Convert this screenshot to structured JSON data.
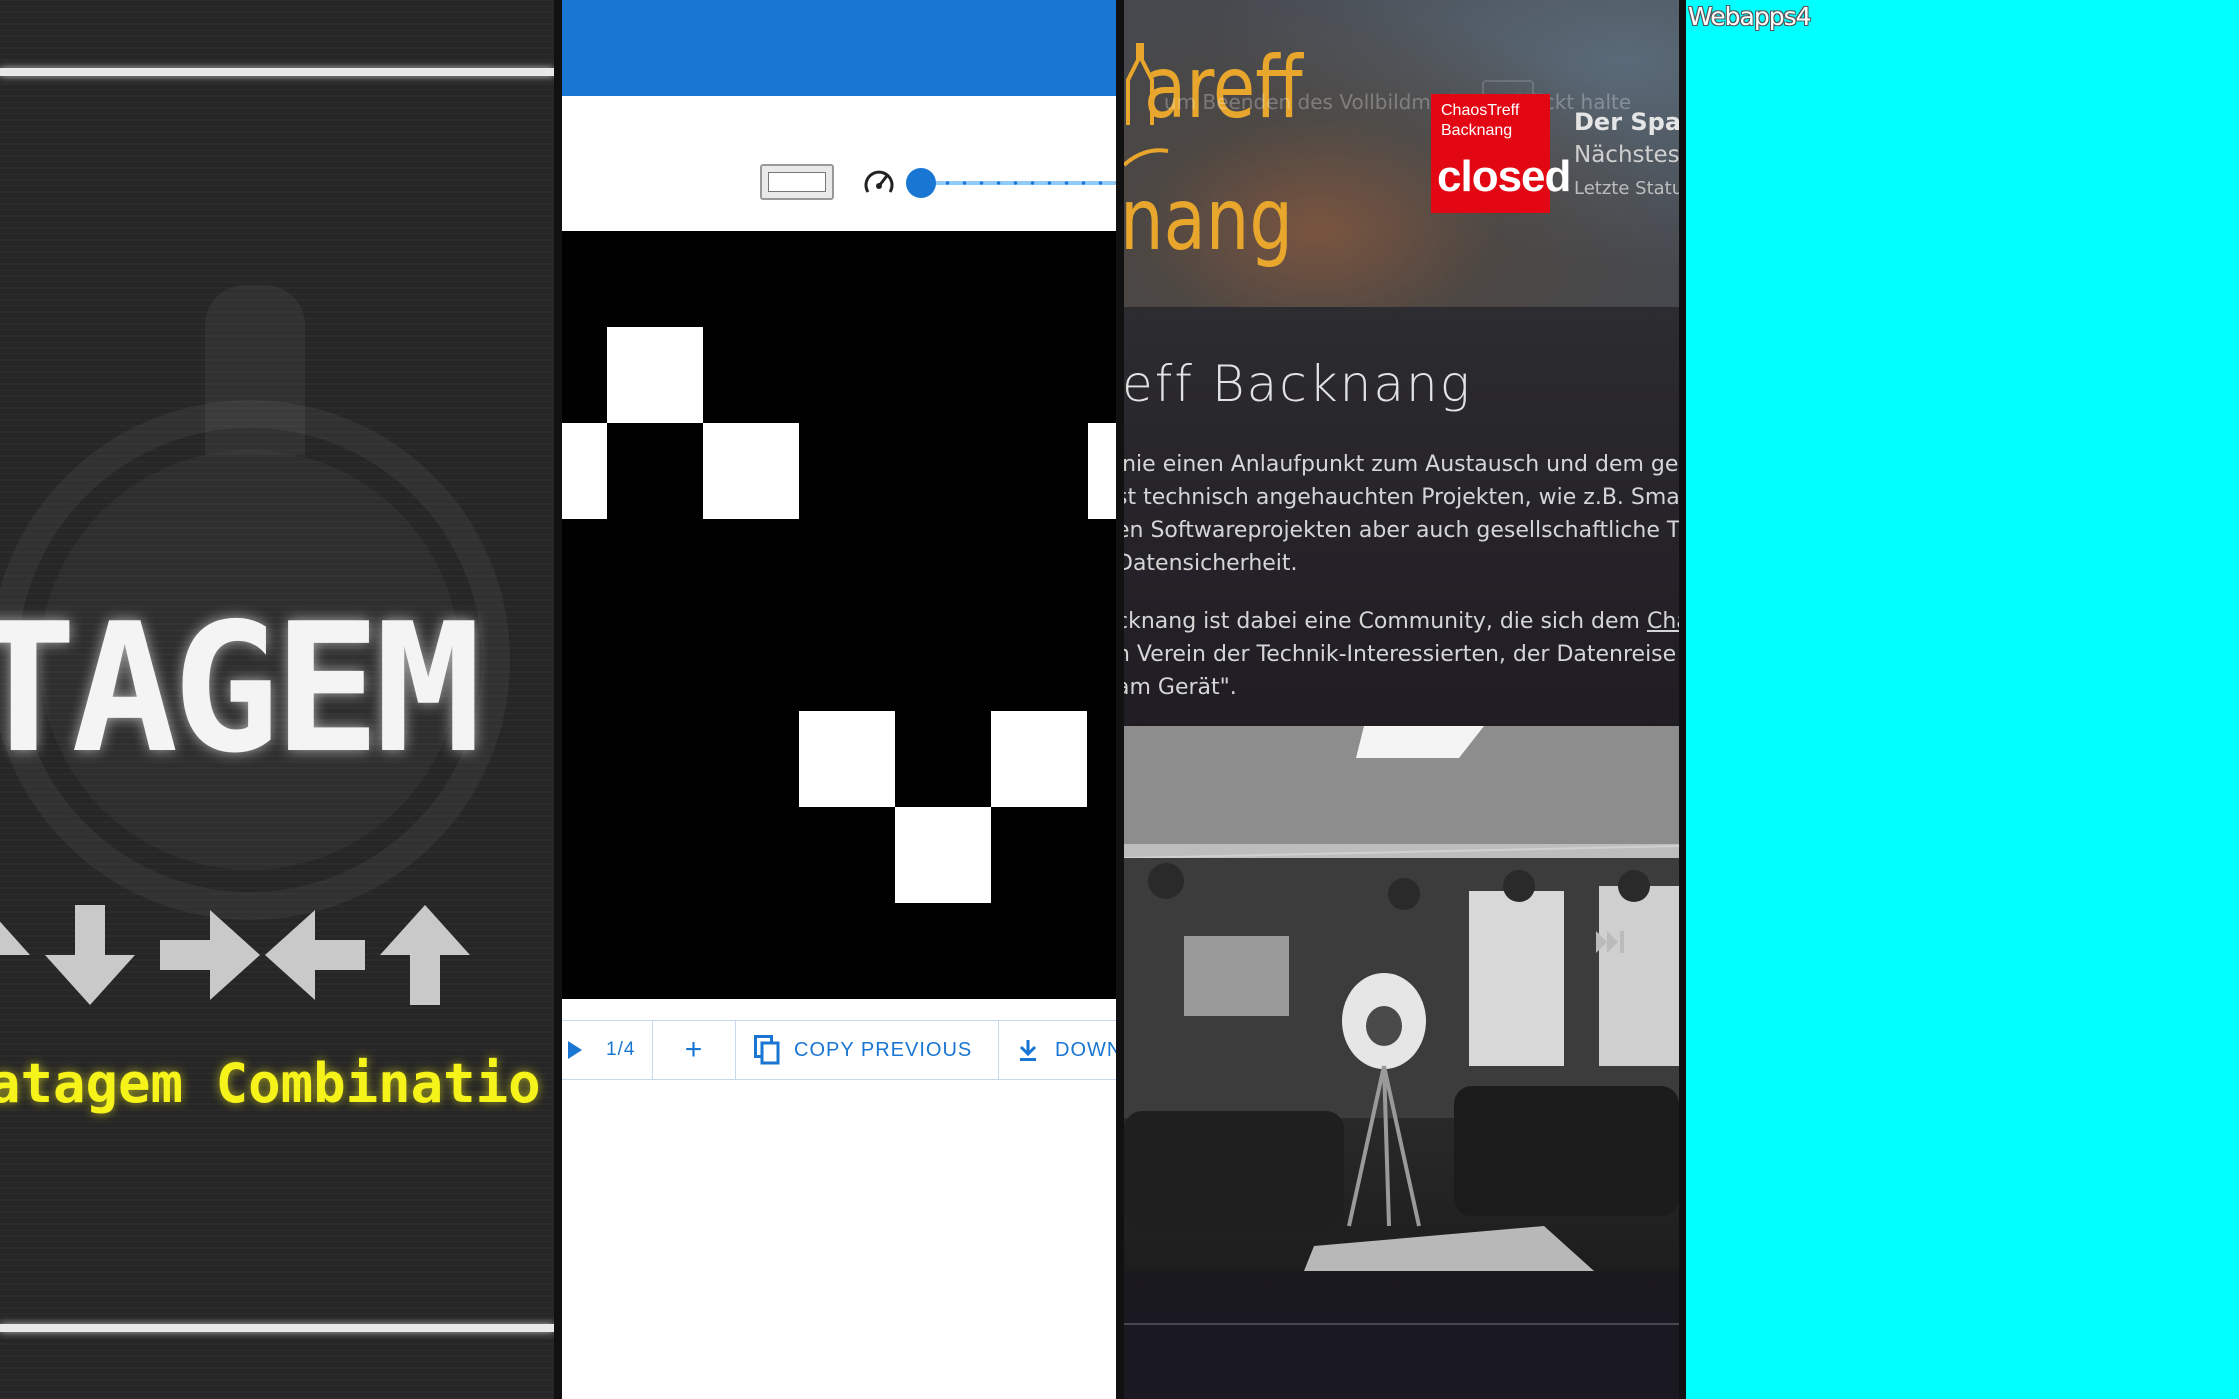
{
  "stratagem": {
    "title": "TAGEM",
    "subtitle": "atagem Combinatio",
    "arrows": [
      "up",
      "down",
      "right",
      "left",
      "up"
    ]
  },
  "pixel_editor": {
    "frame_counter": "1/4",
    "copy_previous_label": "COPY PREVIOUS",
    "download_label": "DOWN",
    "add_label": "+"
  },
  "chaostreff": {
    "logo_top": "areff",
    "logo_bottom": "nang",
    "fullscreen_hint": "um Beenden des Vollbildmodus      gedrückt halte",
    "badge_small_line1": "ChaosTreff",
    "badge_small_line2": "Backnang",
    "badge_status": "closed",
    "space_title": "Der Spac",
    "space_next": "Nächstes",
    "space_last": "Letzte Statu",
    "heading": "eff Backnang",
    "para1": [
      "inie einen Anlaufpunkt zum Austausch und dem ger",
      "st technisch angehauchten Projekten, wie z.B. Smar",
      "en Softwareprojekten aber auch gesellschaftliche The",
      "Datensicherheit."
    ],
    "para2_line1_prefix": "cknang ist dabei eine Community, die sich dem ",
    "para2_link": "Chao",
    "para2_lines": [
      "n Verein der Technik-Interessierten, der Datenreise",
      "am Gerät\"."
    ]
  },
  "webapps": {
    "label": "Webapps4"
  },
  "colors": {
    "stratagem_bg": "#262626",
    "stratagem_yellow": "#f6f31a",
    "editor_blue": "#1976d2",
    "chaos_orange": "#e8a72c",
    "chaos_red": "#e30613",
    "webapps_cyan": "#00ffff"
  }
}
